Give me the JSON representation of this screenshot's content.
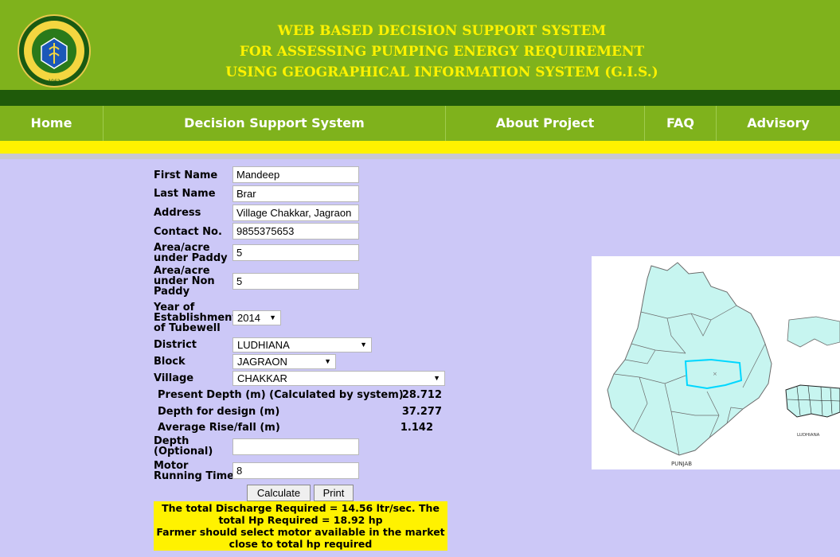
{
  "header": {
    "title_lines": [
      "WEB BASED DECISION SUPPORT SYSTEM",
      "FOR ASSESSING PUMPING ENERGY REQUIREMENT",
      "USING GEOGRAPHICAL INFORMATION SYSTEM (G.I.S.)"
    ],
    "logo_ring_text": "PUNJAB AGRICULTURAL UNIVERSITY",
    "logo_year": "1962"
  },
  "nav": [
    "Home",
    "Decision Support System",
    "About Project",
    "FAQ",
    "Advisory"
  ],
  "form": {
    "first_name": {
      "label": "First Name",
      "value": "Mandeep"
    },
    "last_name": {
      "label": "Last Name",
      "value": "Brar"
    },
    "address": {
      "label": "Address",
      "value": "Village Chakkar, Jagraon"
    },
    "contact": {
      "label": "Contact No.",
      "value": "9855375653"
    },
    "area_paddy": {
      "label_lines": [
        "Area/acre",
        "under Paddy"
      ],
      "value": "5"
    },
    "area_non_paddy": {
      "label_lines": [
        "Area/acre",
        "under Non",
        "Paddy"
      ],
      "value": "5"
    },
    "year": {
      "label_lines": [
        "Year of",
        "Establishment",
        "of Tubewell"
      ],
      "value": "2014"
    },
    "district": {
      "label": "District",
      "value": "LUDHIANA"
    },
    "block": {
      "label": "Block",
      "value": "JAGRAON"
    },
    "village": {
      "label": "Village",
      "value": "CHAKKAR"
    },
    "present_depth": {
      "label": "Present Depth (m) (Calculated by system)",
      "value": "28.712"
    },
    "design_depth": {
      "label": "Depth for design (m)",
      "value": "37.277"
    },
    "rise_fall": {
      "label": "Average Rise/fall (m)",
      "value": "1.142"
    },
    "depth_optional": {
      "label_lines": [
        "Depth",
        "(Optional)"
      ],
      "value": ""
    },
    "motor_time": {
      "label_lines": [
        "Motor",
        "Running Time"
      ],
      "value": "8"
    },
    "calculate_label": "Calculate",
    "print_label": "Print"
  },
  "result": {
    "lines": [
      "The total Discharge Required = 14.56 ltr/sec. The",
      "total Hp Required = 18.92 hp",
      "Farmer should select motor available in the market",
      "close to total hp required"
    ]
  },
  "map": {
    "state_label": "PUNJAB",
    "district_label": "LUDHIANA",
    "colors": {
      "fill": "#c7f5f0",
      "highlight": "#00d7ff",
      "border": "#6b6b6b"
    }
  }
}
